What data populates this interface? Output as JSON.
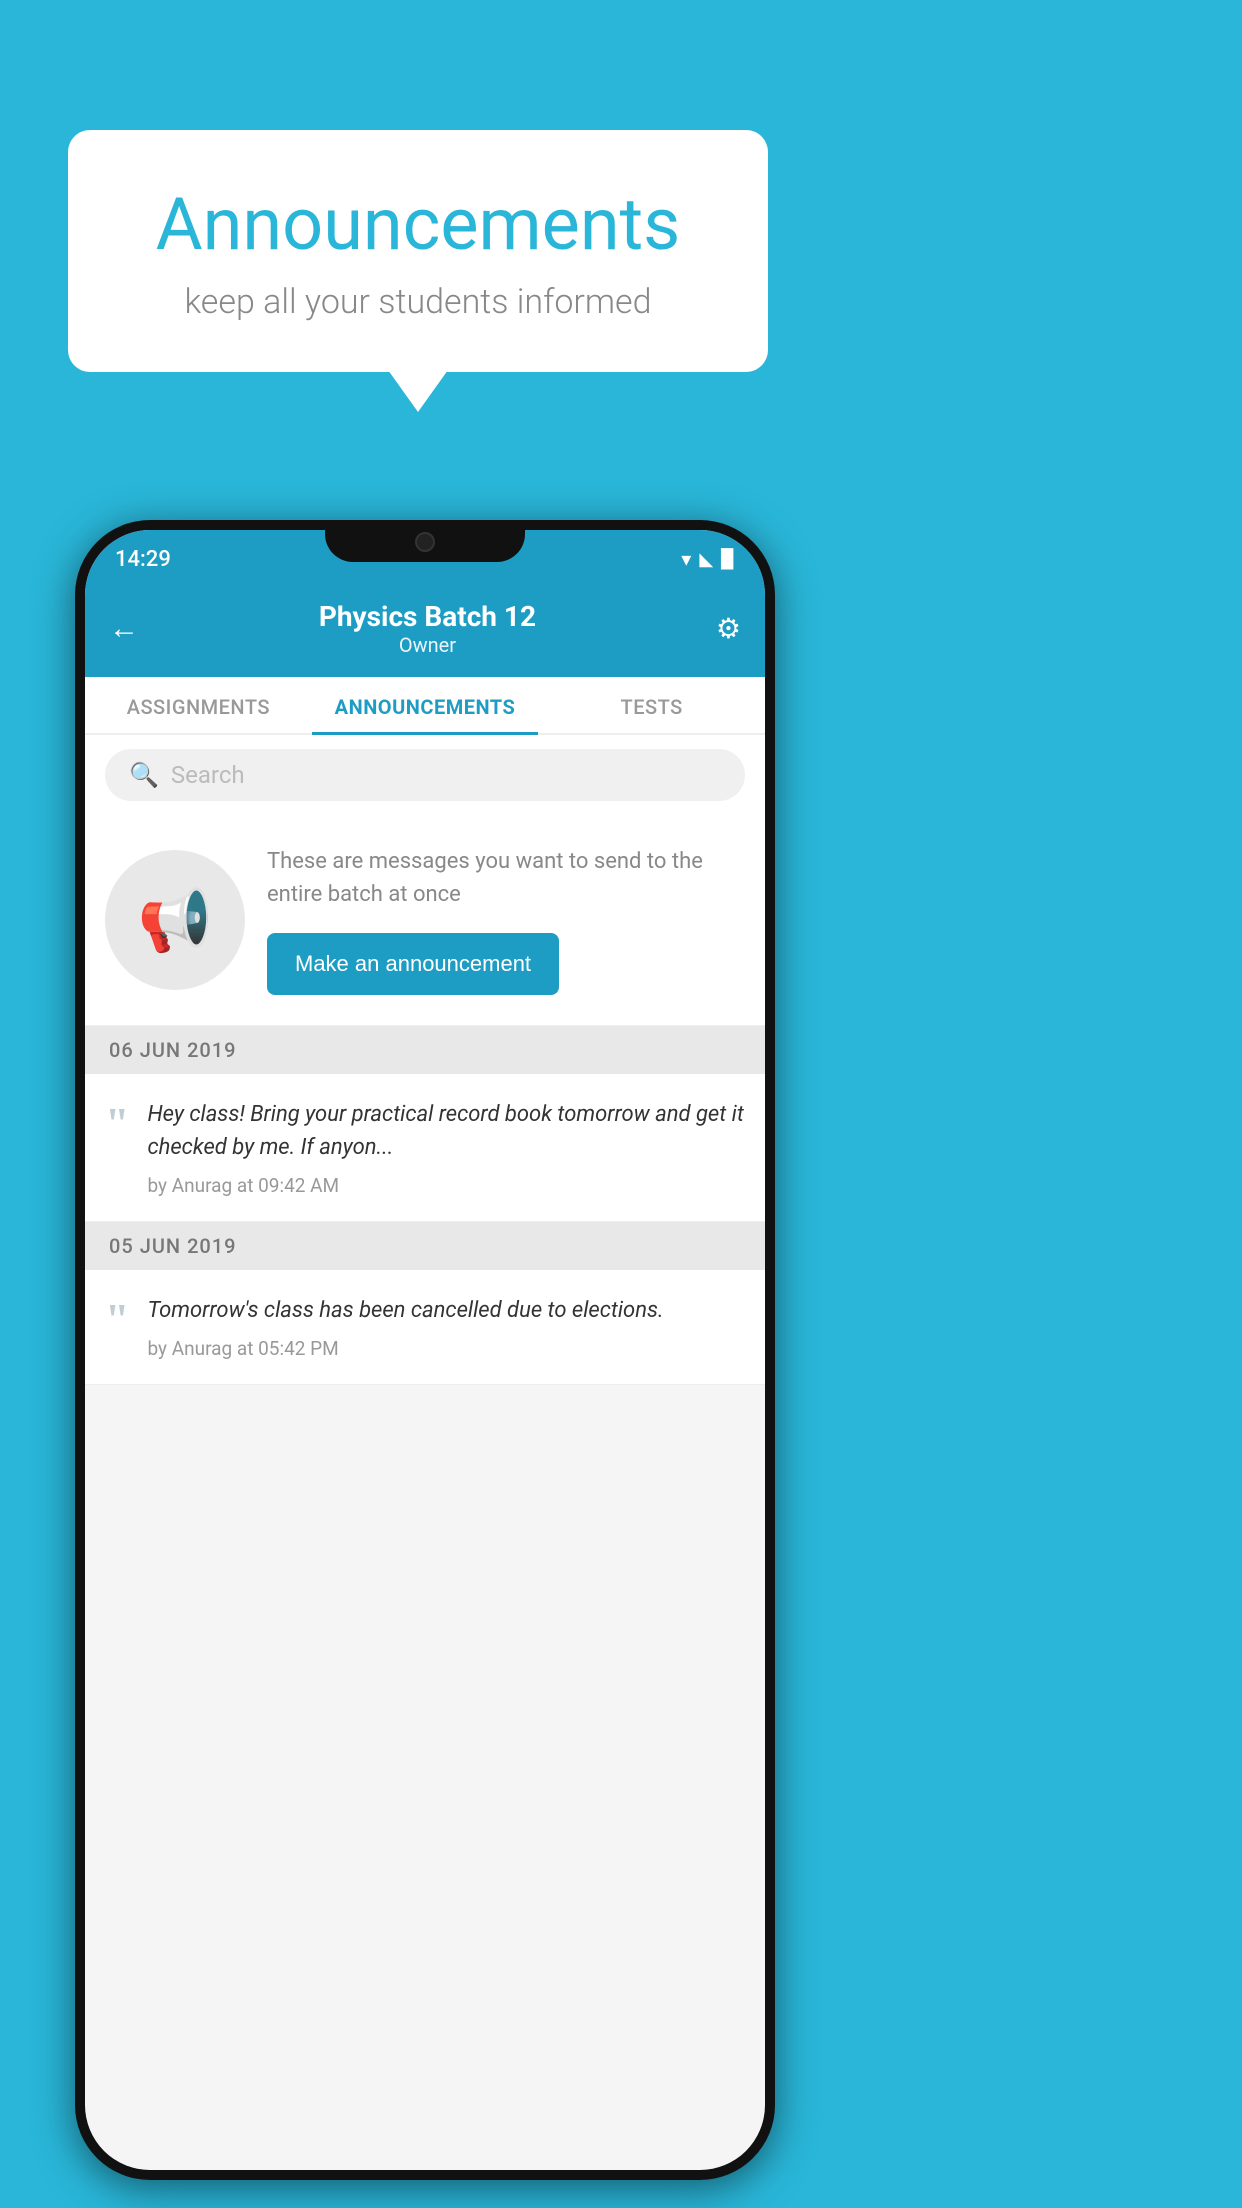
{
  "background_color": "#29b6d8",
  "speech_bubble": {
    "title": "Announcements",
    "subtitle": "keep all your students informed"
  },
  "phone": {
    "status_bar": {
      "time": "14:29",
      "wifi": "▾",
      "signal": "▲",
      "battery": "▉"
    },
    "header": {
      "back_label": "←",
      "batch_name": "Physics Batch 12",
      "role": "Owner",
      "gear_label": "⚙"
    },
    "tabs": [
      {
        "label": "ASSIGNMENTS",
        "active": false
      },
      {
        "label": "ANNOUNCEMENTS",
        "active": true
      },
      {
        "label": "TESTS",
        "active": false
      }
    ],
    "search": {
      "placeholder": "Search"
    },
    "promo": {
      "description": "These are messages you want to send to the entire batch at once",
      "button_label": "Make an announcement"
    },
    "announcements": [
      {
        "date": "06  JUN  2019",
        "message": "Hey class! Bring your practical record book tomorrow and get it checked by me. If anyon...",
        "meta": "by Anurag at 09:42 AM"
      },
      {
        "date": "05  JUN  2019",
        "message": "Tomorrow's class has been cancelled due to elections.",
        "meta": "by Anurag at 05:42 PM"
      }
    ]
  }
}
